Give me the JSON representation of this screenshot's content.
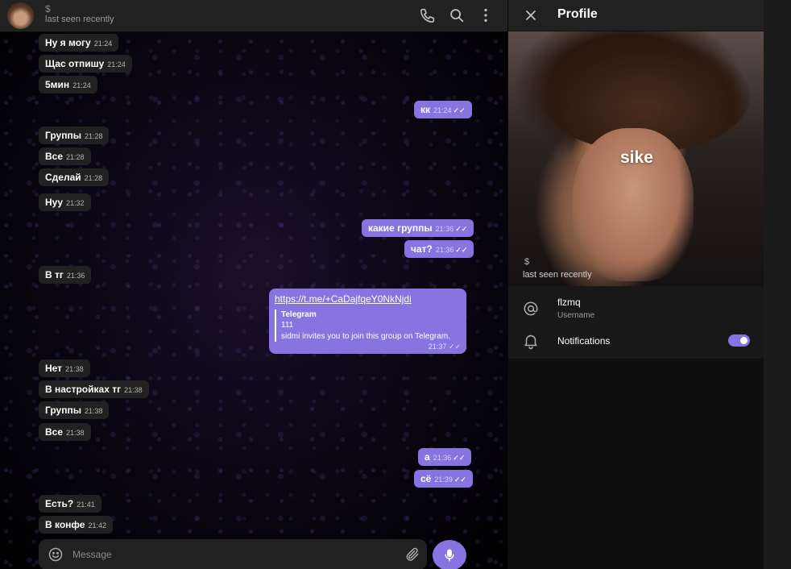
{
  "chat_header": {
    "name": "$",
    "status": "last seen recently",
    "icons": [
      "phone-icon",
      "search-icon",
      "more-vertical-icon"
    ]
  },
  "messages": [
    {
      "dir": "in",
      "text": "Ну я могу",
      "time": "21:24"
    },
    {
      "dir": "in",
      "text": "Щас отпишу",
      "time": "21:24"
    },
    {
      "dir": "in",
      "text": "5мин",
      "time": "21:24"
    },
    {
      "dir": "out",
      "text": "кк",
      "time": "21:24",
      "read": "✓✓"
    },
    {
      "dir": "in",
      "text": "Группы",
      "time": "21:28"
    },
    {
      "dir": "in",
      "text": "Все",
      "time": "21:28"
    },
    {
      "dir": "in",
      "text": "Сделай",
      "time": "21:28"
    },
    {
      "dir": "in",
      "text": "Нуу",
      "time": "21:32"
    },
    {
      "dir": "out",
      "text": "какие группы",
      "time": "21:36",
      "read": "✓✓"
    },
    {
      "dir": "out",
      "text": "чат?",
      "time": "21:36",
      "read": "✓✓"
    },
    {
      "dir": "in",
      "text": "В тг",
      "time": "21:36"
    },
    {
      "dir": "in",
      "text": "Нет",
      "time": "21:38"
    },
    {
      "dir": "in",
      "text": "В настройках тг",
      "time": "21:38"
    },
    {
      "dir": "in",
      "text": "Группы",
      "time": "21:38"
    },
    {
      "dir": "in",
      "text": "Все",
      "time": "21:38"
    },
    {
      "dir": "out",
      "text": "а",
      "time": "21:36",
      "read": "✓✓"
    },
    {
      "dir": "out",
      "text": "сё",
      "time": "21:39",
      "read": "✓✓"
    },
    {
      "dir": "in",
      "text": "Есть?",
      "time": "21:41"
    },
    {
      "dir": "in",
      "text": "В конфе",
      "time": "21:42"
    }
  ],
  "link_message": {
    "url": "https://t.me/+CaDajfqeY0NkNjdi",
    "preview_title": "Telegram",
    "preview_subtitle": "111",
    "preview_description": "sidmi invites you to join this group on Telegram.",
    "time": "21:37",
    "read": "✓✓"
  },
  "composer": {
    "placeholder": "Message",
    "icons": [
      "smile-icon",
      "attach-icon",
      "mic-icon"
    ]
  },
  "profile": {
    "title": "Profile",
    "photo_sticker_text": "sike",
    "photo_name": "$",
    "photo_status": "last seen recently",
    "username": "flzmq",
    "username_label": "Username",
    "notifications_label": "Notifications",
    "notifications_on": true
  },
  "colors": {
    "accent": "#8774e1",
    "header_bg": "#212121",
    "incoming_bubble": "#212121"
  }
}
